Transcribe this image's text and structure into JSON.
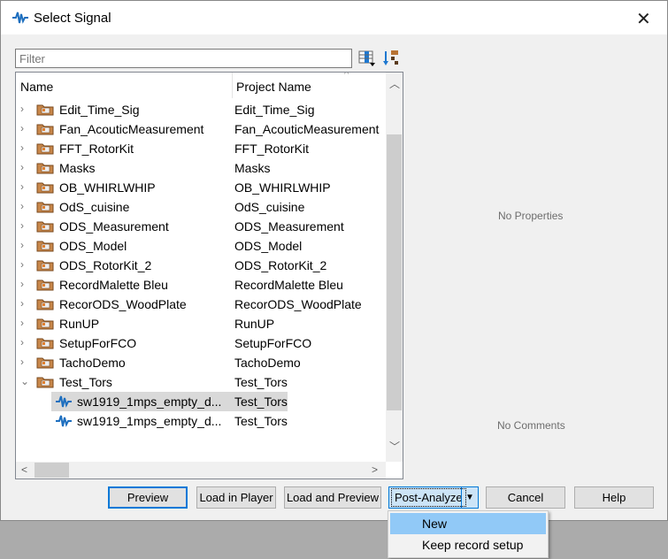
{
  "window": {
    "title": "Select Signal",
    "close_label": "✕"
  },
  "filter": {
    "placeholder": "Filter",
    "value": ""
  },
  "columns": {
    "name": "Name",
    "project": "Project Name"
  },
  "rows": [
    {
      "name": "Edit_Time_Sig",
      "project": "Edit_Time_Sig",
      "type": "folder",
      "expanded": false
    },
    {
      "name": "Fan_AcouticMeasurement",
      "project": "Fan_AcouticMeasurement",
      "type": "folder",
      "expanded": false
    },
    {
      "name": "FFT_RotorKit",
      "project": "FFT_RotorKit",
      "type": "folder",
      "expanded": false
    },
    {
      "name": "Masks",
      "project": "Masks",
      "type": "folder",
      "expanded": false
    },
    {
      "name": "OB_WHIRLWHIP",
      "project": "OB_WHIRLWHIP",
      "type": "folder",
      "expanded": false
    },
    {
      "name": "OdS_cuisine",
      "project": "OdS_cuisine",
      "type": "folder",
      "expanded": false
    },
    {
      "name": "ODS_Measurement",
      "project": "ODS_Measurement",
      "type": "folder",
      "expanded": false
    },
    {
      "name": "ODS_Model",
      "project": "ODS_Model",
      "type": "folder",
      "expanded": false
    },
    {
      "name": "ODS_RotorKit_2",
      "project": "ODS_RotorKit_2",
      "type": "folder",
      "expanded": false
    },
    {
      "name": "RecordMalette Bleu",
      "project": "RecordMalette Bleu",
      "type": "folder",
      "expanded": false
    },
    {
      "name": "RecorODS_WoodPlate",
      "project": "RecorODS_WoodPlate",
      "type": "folder",
      "expanded": false
    },
    {
      "name": "RunUP",
      "project": "RunUP",
      "type": "folder",
      "expanded": false
    },
    {
      "name": "SetupForFCO",
      "project": "SetupForFCO",
      "type": "folder",
      "expanded": false
    },
    {
      "name": "TachoDemo",
      "project": "TachoDemo",
      "type": "folder",
      "expanded": false
    },
    {
      "name": "Test_Tors",
      "project": "Test_Tors",
      "type": "folder",
      "expanded": true
    },
    {
      "name": "sw1919_1mps_empty_d...",
      "project": "Test_Tors",
      "type": "signal",
      "selected": true
    },
    {
      "name": "sw1919_1mps_empty_d...",
      "project": "Test_Tors",
      "type": "signal",
      "selected": false
    }
  ],
  "panel": {
    "properties": "No Properties",
    "comments": "No Comments"
  },
  "buttons": {
    "preview": "Preview",
    "load_player": "Load in Player",
    "load_preview": "Load and Preview",
    "post_analyze": "Post-Analyze",
    "cancel": "Cancel",
    "help": "Help"
  },
  "menu": {
    "items": [
      "New",
      "Keep record setup"
    ],
    "highlighted": "New"
  },
  "colors": {
    "accent": "#0078d7",
    "highlight": "#91c9f7",
    "signal": "#1e6fbf"
  }
}
